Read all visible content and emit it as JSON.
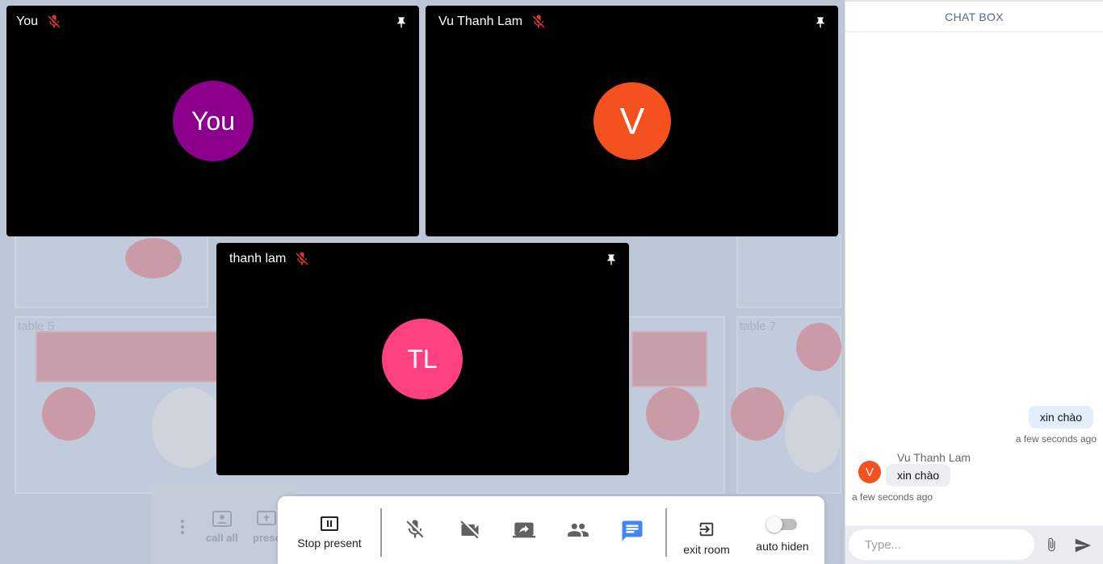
{
  "tiles": [
    {
      "name": "You",
      "avatar_text": "You",
      "avatar_color": "#8b008b"
    },
    {
      "name": "Vu Thanh Lam",
      "avatar_text": "V",
      "avatar_color": "#f4511e"
    },
    {
      "name": "thanh lam",
      "avatar_text": "TL",
      "avatar_color": "#ff4081"
    }
  ],
  "map": {
    "table_labels": [
      "table 5",
      "table 7"
    ]
  },
  "sub_toolbar": {
    "call_all_label": "call all",
    "present_label": "prese"
  },
  "controls": {
    "stop_present_label": "Stop present",
    "exit_room_label": "exit room",
    "auto_hide_label": "auto hiden",
    "active_color": "#4285f4"
  },
  "chat": {
    "title": "CHAT BOX",
    "my_message": "xin chào",
    "my_message_time": "a few seconds ago",
    "other_sender": "Vu Thanh Lam",
    "other_avatar_text": "V",
    "other_message": "xin chào",
    "other_message_time": "a few seconds ago",
    "input_placeholder": "Type..."
  },
  "colors": {
    "mic_off": "#e53935"
  }
}
